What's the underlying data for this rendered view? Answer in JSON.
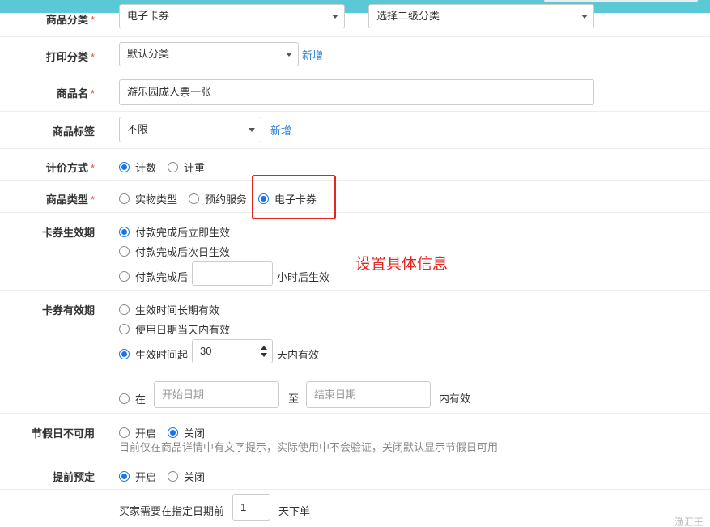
{
  "form": {
    "category": {
      "label": "商品分类",
      "primary_value": "电子卡券",
      "secondary_placeholder": "选择二级分类"
    },
    "print_category": {
      "label": "打印分类",
      "value": "默认分类",
      "add_link": "新增"
    },
    "product_name": {
      "label": "商品名",
      "value": "游乐园成人票一张"
    },
    "product_tag": {
      "label": "商品标签",
      "value": "不限",
      "add_link": "新增"
    },
    "pricing": {
      "label": "计价方式",
      "options": [
        "计数",
        "计重"
      ],
      "selected": "计数"
    },
    "product_type": {
      "label": "商品类型",
      "options": [
        "实物类型",
        "预约服务",
        "电子卡券"
      ],
      "selected": "电子卡券"
    },
    "effective_time": {
      "label": "卡券生效期",
      "option1": "付款完成后立即生效",
      "option2": "付款完成后次日生效",
      "option3_prefix": "付款完成后",
      "option3_suffix": "小时后生效",
      "hours_value": "",
      "selected": "付款完成后立即生效"
    },
    "validity": {
      "label": "卡券有效期",
      "option1": "生效时间长期有效",
      "option2": "使用日期当天内有效",
      "option3_prefix": "生效时间起",
      "days_value": "30",
      "option3_suffix": "天内有效",
      "option4_prefix": "在",
      "start_placeholder": "开始日期",
      "to_text": "至",
      "end_placeholder": "结束日期",
      "option4_suffix": "内有效",
      "selected": "生效时间起"
    },
    "holiday": {
      "label": "节假日不可用",
      "on_label": "开启",
      "off_label": "关闭",
      "selected": "关闭",
      "hint": "目前仅在商品详情中有文字提示，实际使用中不会验证，关闭默认显示节假日可用"
    },
    "advance_booking": {
      "label": "提前预定",
      "on_label": "开启",
      "off_label": "关闭",
      "selected": "开启",
      "days_prefix": "买家需要在指定日期前",
      "days_value": "1",
      "days_suffix": "天下单"
    }
  },
  "annotation": {
    "text": "设置具体信息",
    "color": "#e3251e"
  },
  "colors": {
    "accent": "#1a73e8",
    "link": "#2f7fd8",
    "topbar": "#5bc8d6",
    "required": "#e84b4b"
  },
  "watermark": "渔汇王"
}
